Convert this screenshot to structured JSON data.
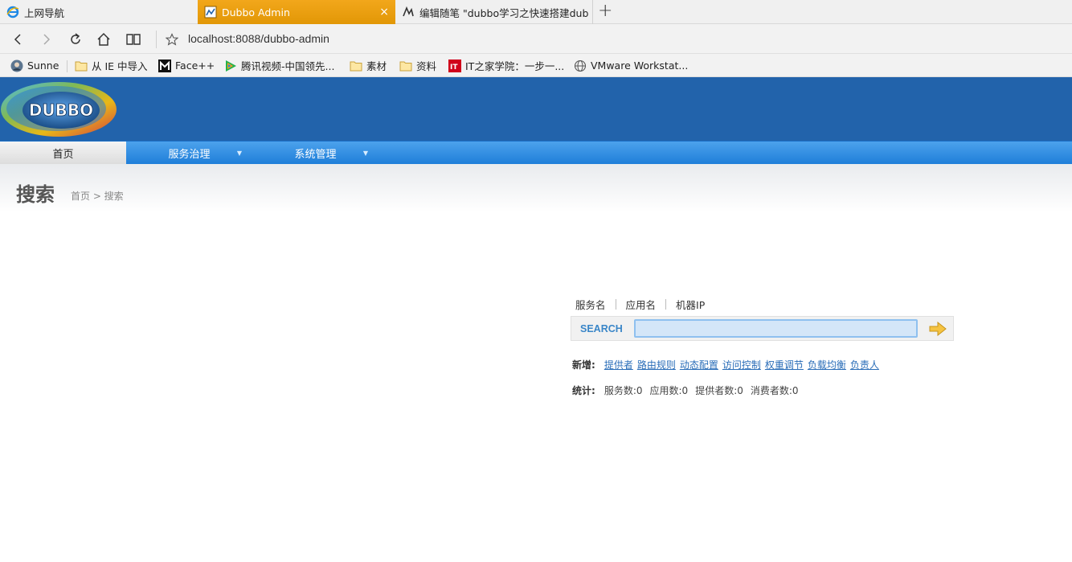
{
  "tabs": [
    {
      "title": "上网导航",
      "icon": "ie-icon"
    },
    {
      "title": "Dubbo Admin",
      "icon": "dubbo-favicon",
      "close": "×"
    },
    {
      "title": "编辑随笔 \"dubbo学习之快速搭建dub",
      "icon": "cnblogs-icon"
    }
  ],
  "new_tab": "+",
  "address": {
    "url": "localhost:8088/dubbo-admin"
  },
  "favorites": [
    {
      "label": "Sunne",
      "icon": "avatar-icon"
    },
    {
      "label": "从 IE 中导入",
      "icon": "folder-icon"
    },
    {
      "label": "Face++",
      "icon": "faceplusplus-icon"
    },
    {
      "label": "腾讯视频-中国领先...",
      "icon": "tencent-video-icon"
    },
    {
      "label": "素材",
      "icon": "folder-icon"
    },
    {
      "label": "资料",
      "icon": "folder-icon"
    },
    {
      "label": "IT之家学院：一步一...",
      "icon": "ithome-icon"
    },
    {
      "label": "VMware Workstat...",
      "icon": "globe-icon"
    }
  ],
  "logo_text": "DUBBO",
  "menu": [
    {
      "label": "首页"
    },
    {
      "label": "服务治理"
    },
    {
      "label": "系统管理"
    }
  ],
  "page": {
    "title": "搜索",
    "breadcrumb": "首页 > 搜索"
  },
  "search": {
    "tabs": [
      "服务名",
      "应用名",
      "机器IP"
    ],
    "label": "SEARCH",
    "value": ""
  },
  "add": {
    "label": "新增:",
    "links": [
      "提供者",
      "路由规则",
      "动态配置",
      "访问控制",
      "权重调节",
      "负载均衡",
      "负责人"
    ]
  },
  "stats": {
    "label": "统计:",
    "items": [
      "服务数:0",
      "应用数:0",
      "提供者数:0",
      "消费者数:0"
    ]
  },
  "colors": {
    "header": "#2263ab",
    "menu": "#2e8ee3",
    "active_tab": "#f2a71b",
    "link": "#2a6db8"
  }
}
